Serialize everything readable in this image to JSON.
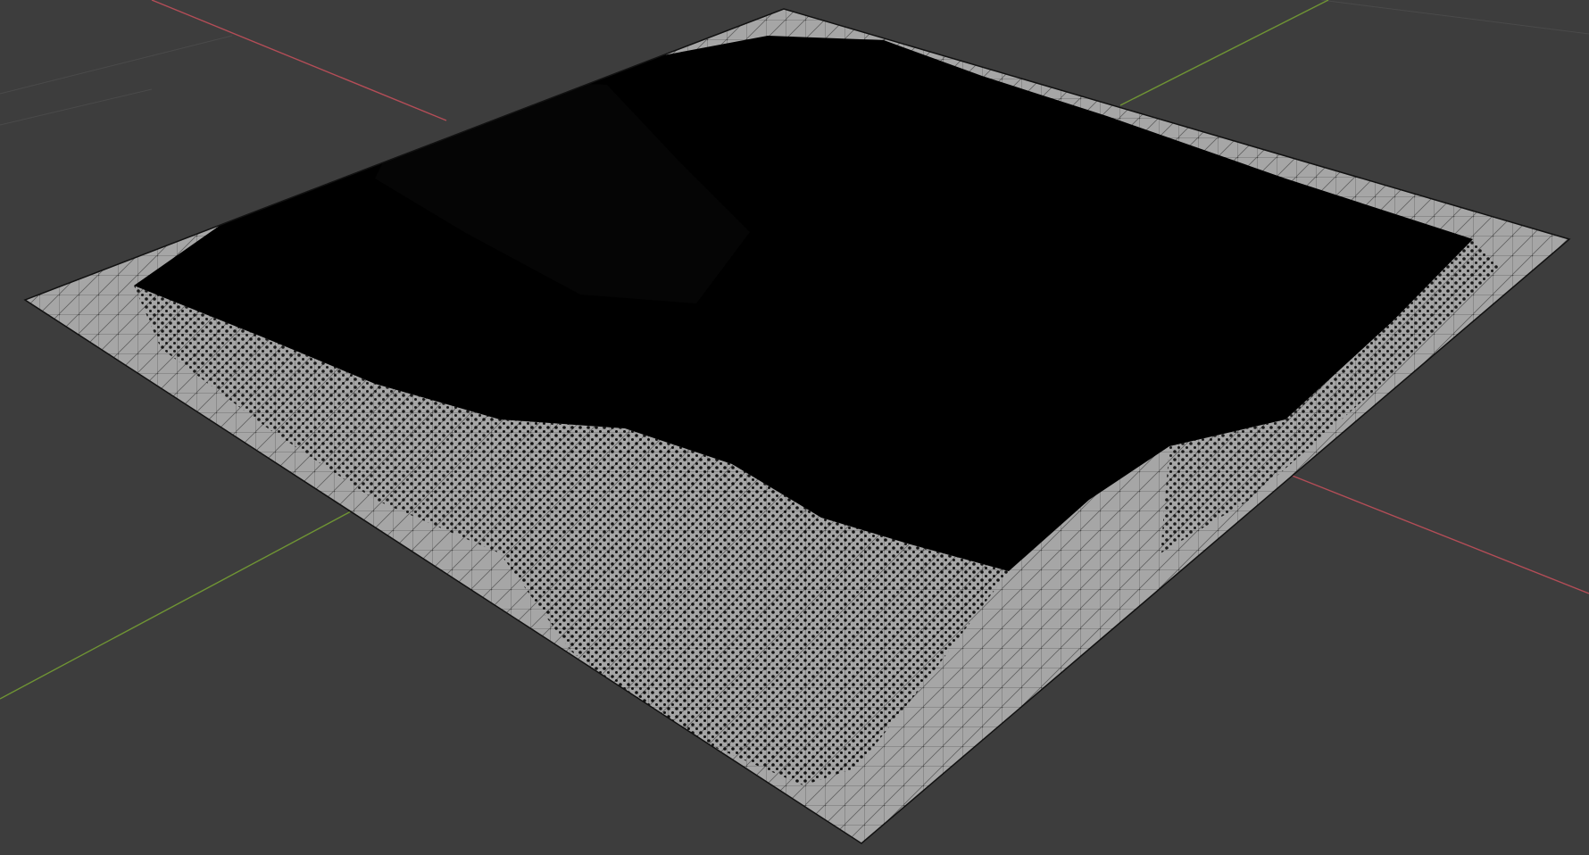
{
  "viewport": {
    "background_color": "#3d3d3d",
    "grid_line_color": "#4a4a4a",
    "x_axis_color": "#b34d57",
    "y_axis_color": "#6f9434",
    "mesh_face_color": "#a6a6a6",
    "mesh_wire_color": "#000000",
    "mode": "edit-mode-wireframe"
  },
  "object": {
    "type": "terrain-mesh"
  }
}
